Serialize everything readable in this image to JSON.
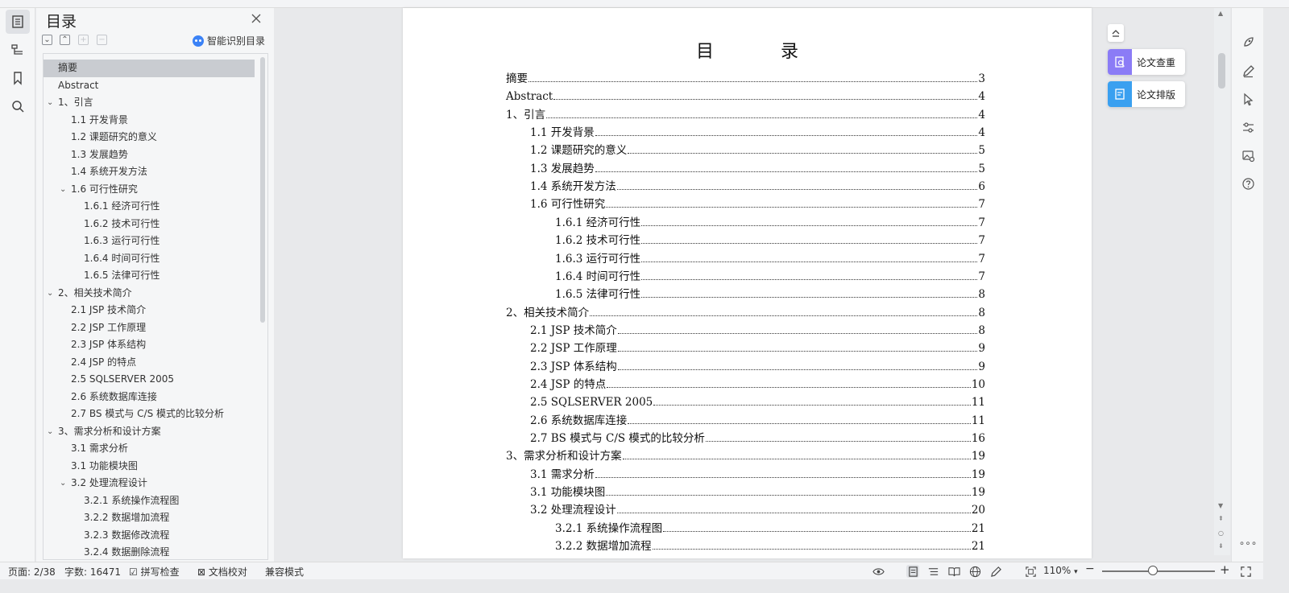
{
  "colors": {
    "accent": "#3b82f6",
    "selected_row": "#c9ccd1",
    "check_card": "#8b7cf6",
    "format_card": "#3aa0f0"
  },
  "outline": {
    "title": "目录",
    "smart_toc": "智能识别目录",
    "items": [
      {
        "label": "摘要",
        "level": 0,
        "selected": true
      },
      {
        "label": "Abstract",
        "level": 0
      },
      {
        "label": "1、引言",
        "level": 0,
        "expanded": true
      },
      {
        "label": "1.1 开发背景",
        "level": 1
      },
      {
        "label": "1.2 课题研究的意义",
        "level": 1
      },
      {
        "label": "1.3 发展趋势",
        "level": 1
      },
      {
        "label": "1.4 系统开发方法",
        "level": 1
      },
      {
        "label": "1.6 可行性研究",
        "level": 1,
        "expanded": true
      },
      {
        "label": "1.6.1 经济可行性",
        "level": 2
      },
      {
        "label": "1.6.2 技术可行性",
        "level": 2
      },
      {
        "label": "1.6.3 运行可行性",
        "level": 2
      },
      {
        "label": "1.6.4 时间可行性",
        "level": 2
      },
      {
        "label": "1.6.5 法律可行性",
        "level": 2
      },
      {
        "label": "2、相关技术简介",
        "level": 0,
        "expanded": true
      },
      {
        "label": "2.1 JSP 技术简介",
        "level": 1
      },
      {
        "label": "2.2 JSP 工作原理",
        "level": 1
      },
      {
        "label": "2.3 JSP 体系结构",
        "level": 1
      },
      {
        "label": "2.4 JSP 的特点",
        "level": 1
      },
      {
        "label": "2.5 SQLSERVER 2005",
        "level": 1
      },
      {
        "label": "2.6 系统数据库连接",
        "level": 1
      },
      {
        "label": "2.7 BS 模式与 C/S 模式的比较分析",
        "level": 1
      },
      {
        "label": "3、需求分析和设计方案",
        "level": 0,
        "expanded": true
      },
      {
        "label": "3.1 需求分析",
        "level": 1
      },
      {
        "label": "3.1 功能模块图",
        "level": 1
      },
      {
        "label": "3.2 处理流程设计",
        "level": 1,
        "expanded": true
      },
      {
        "label": "3.2.1 系统操作流程图",
        "level": 2
      },
      {
        "label": "3.2.2 数据增加流程",
        "level": 2
      },
      {
        "label": "3.2.3 数据修改流程",
        "level": 2
      },
      {
        "label": "3.2.4 数据删除流程",
        "level": 2
      }
    ]
  },
  "document": {
    "title": "目 录",
    "entries": [
      {
        "text": "摘要",
        "page": "3",
        "level": 0
      },
      {
        "text": "Abstract",
        "page": "4",
        "level": 0
      },
      {
        "text": "1、引言",
        "page": "4",
        "level": 0
      },
      {
        "text": "1.1 开发背景",
        "page": "4",
        "level": 1
      },
      {
        "text": "1.2 课题研究的意义",
        "page": "5",
        "level": 1
      },
      {
        "text": "1.3 发展趋势",
        "page": "5",
        "level": 1
      },
      {
        "text": "1.4 系统开发方法",
        "page": "6",
        "level": 1
      },
      {
        "text": "1.6 可行性研究",
        "page": "7",
        "level": 1
      },
      {
        "text": "1.6.1 经济可行性",
        "page": "7",
        "level": 2
      },
      {
        "text": "1.6.2 技术可行性",
        "page": "7",
        "level": 2
      },
      {
        "text": "1.6.3 运行可行性",
        "page": "7",
        "level": 2
      },
      {
        "text": "1.6.4 时间可行性",
        "page": "7",
        "level": 2
      },
      {
        "text": "1.6.5 法律可行性",
        "page": "8",
        "level": 2
      },
      {
        "text": "2、相关技术简介",
        "page": "8",
        "level": 0
      },
      {
        "text": "2.1 JSP 技术简介",
        "page": "8",
        "level": 1
      },
      {
        "text": "2.2 JSP 工作原理",
        "page": "9",
        "level": 1
      },
      {
        "text": "2.3 JSP 体系结构",
        "page": "9",
        "level": 1
      },
      {
        "text": "2.4 JSP 的特点",
        "page": "10",
        "level": 1
      },
      {
        "text": "2.5 SQLSERVER 2005",
        "page": "11",
        "level": 1
      },
      {
        "text": "2.6 系统数据库连接",
        "page": "11",
        "level": 1
      },
      {
        "text": "2.7 BS 模式与 C/S 模式的比较分析",
        "page": "16",
        "level": 1
      },
      {
        "text": "3、需求分析和设计方案",
        "page": "19",
        "level": 0
      },
      {
        "text": "3.1 需求分析",
        "page": "19",
        "level": 1
      },
      {
        "text": "3.1 功能模块图",
        "page": "19",
        "level": 1
      },
      {
        "text": "3.2 处理流程设计",
        "page": "20",
        "level": 1
      },
      {
        "text": "3.2.1 系统操作流程图",
        "page": "21",
        "level": 2
      },
      {
        "text": "3.2.2 数据增加流程",
        "page": "21",
        "level": 2
      }
    ]
  },
  "float_panel": {
    "check_label": "论文查重",
    "format_label": "论文排版"
  },
  "status": {
    "page_info": "页面: 2/38",
    "word_count": "字数: 16471",
    "spell_check": "拼写检查",
    "doc_proof": "文档校对",
    "compat_mode": "兼容模式",
    "zoom": "110%",
    "zoom_level": 0.45
  }
}
